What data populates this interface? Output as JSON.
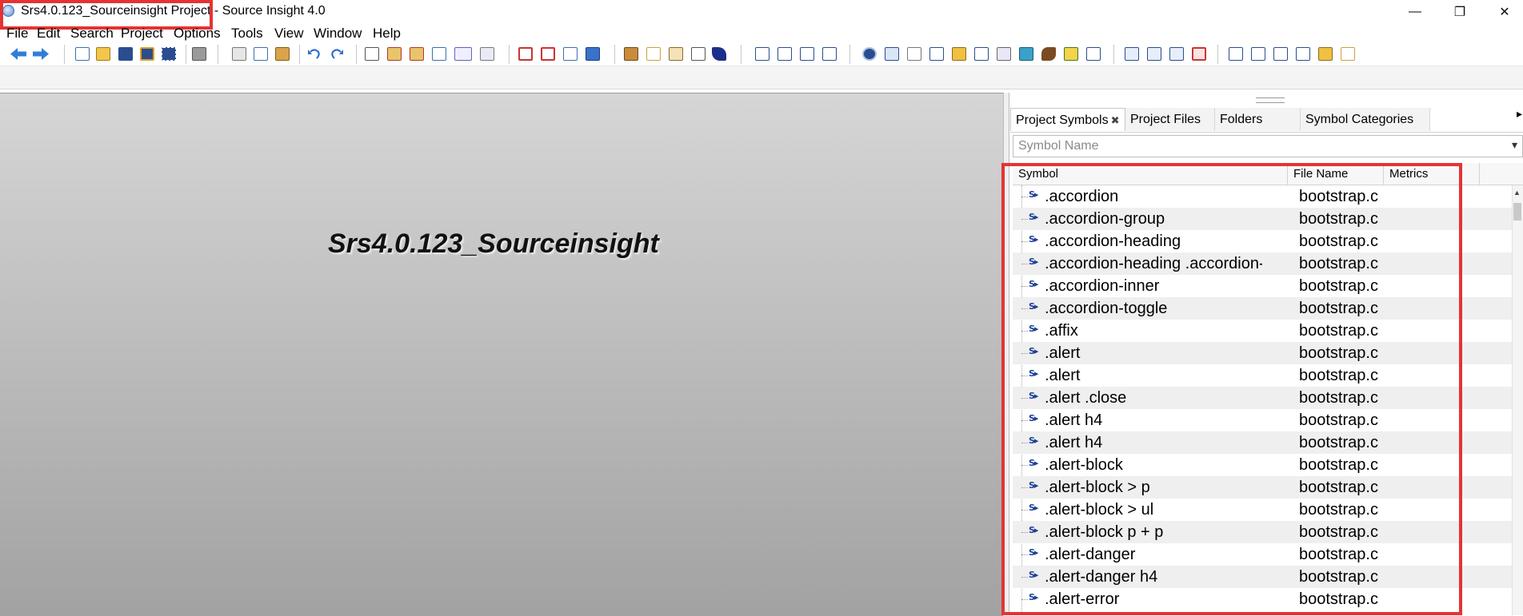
{
  "window": {
    "title": "Srs4.0.123_Sourceinsight Project - Source Insight 4.0",
    "controls": [
      "—",
      "❐",
      "✕"
    ]
  },
  "menu": [
    "File",
    "Edit",
    "Search",
    "Project",
    "Options",
    "Tools",
    "View",
    "Window",
    "Help"
  ],
  "editor": {
    "project_title": "Srs4.0.123_Sourceinsight"
  },
  "panel": {
    "tabs": [
      "Project Symbols",
      "Project Files",
      "Folders",
      "Symbol Categories"
    ],
    "active_tab": "Project Symbols",
    "search": {
      "placeholder": "Symbol Name",
      "value": ""
    },
    "columns": [
      "Symbol",
      "File Name",
      "Metrics"
    ],
    "rows": [
      {
        "symbol": ".accordion",
        "file": "bootstrap.c"
      },
      {
        "symbol": ".accordion-group",
        "file": "bootstrap.c"
      },
      {
        "symbol": ".accordion-heading",
        "file": "bootstrap.c"
      },
      {
        "symbol": ".accordion-heading .accordion-t",
        "file": "bootstrap.c"
      },
      {
        "symbol": ".accordion-inner",
        "file": "bootstrap.c"
      },
      {
        "symbol": ".accordion-toggle",
        "file": "bootstrap.c"
      },
      {
        "symbol": ".affix",
        "file": "bootstrap.c"
      },
      {
        "symbol": ".alert",
        "file": "bootstrap.c"
      },
      {
        "symbol": ".alert",
        "file": "bootstrap.c"
      },
      {
        "symbol": ".alert .close",
        "file": "bootstrap.c"
      },
      {
        "symbol": ".alert h4",
        "file": "bootstrap.c"
      },
      {
        "symbol": ".alert h4",
        "file": "bootstrap.c"
      },
      {
        "symbol": ".alert-block",
        "file": "bootstrap.c"
      },
      {
        "symbol": ".alert-block > p",
        "file": "bootstrap.c"
      },
      {
        "symbol": ".alert-block > ul",
        "file": "bootstrap.c"
      },
      {
        "symbol": ".alert-block p + p",
        "file": "bootstrap.c"
      },
      {
        "symbol": ".alert-danger",
        "file": "bootstrap.c"
      },
      {
        "symbol": ".alert-danger h4",
        "file": "bootstrap.c"
      },
      {
        "symbol": ".alert-error",
        "file": "bootstrap.c"
      }
    ]
  },
  "colors": {
    "highlight": "#e53333",
    "symbol_icon": "#1c3f9c"
  }
}
